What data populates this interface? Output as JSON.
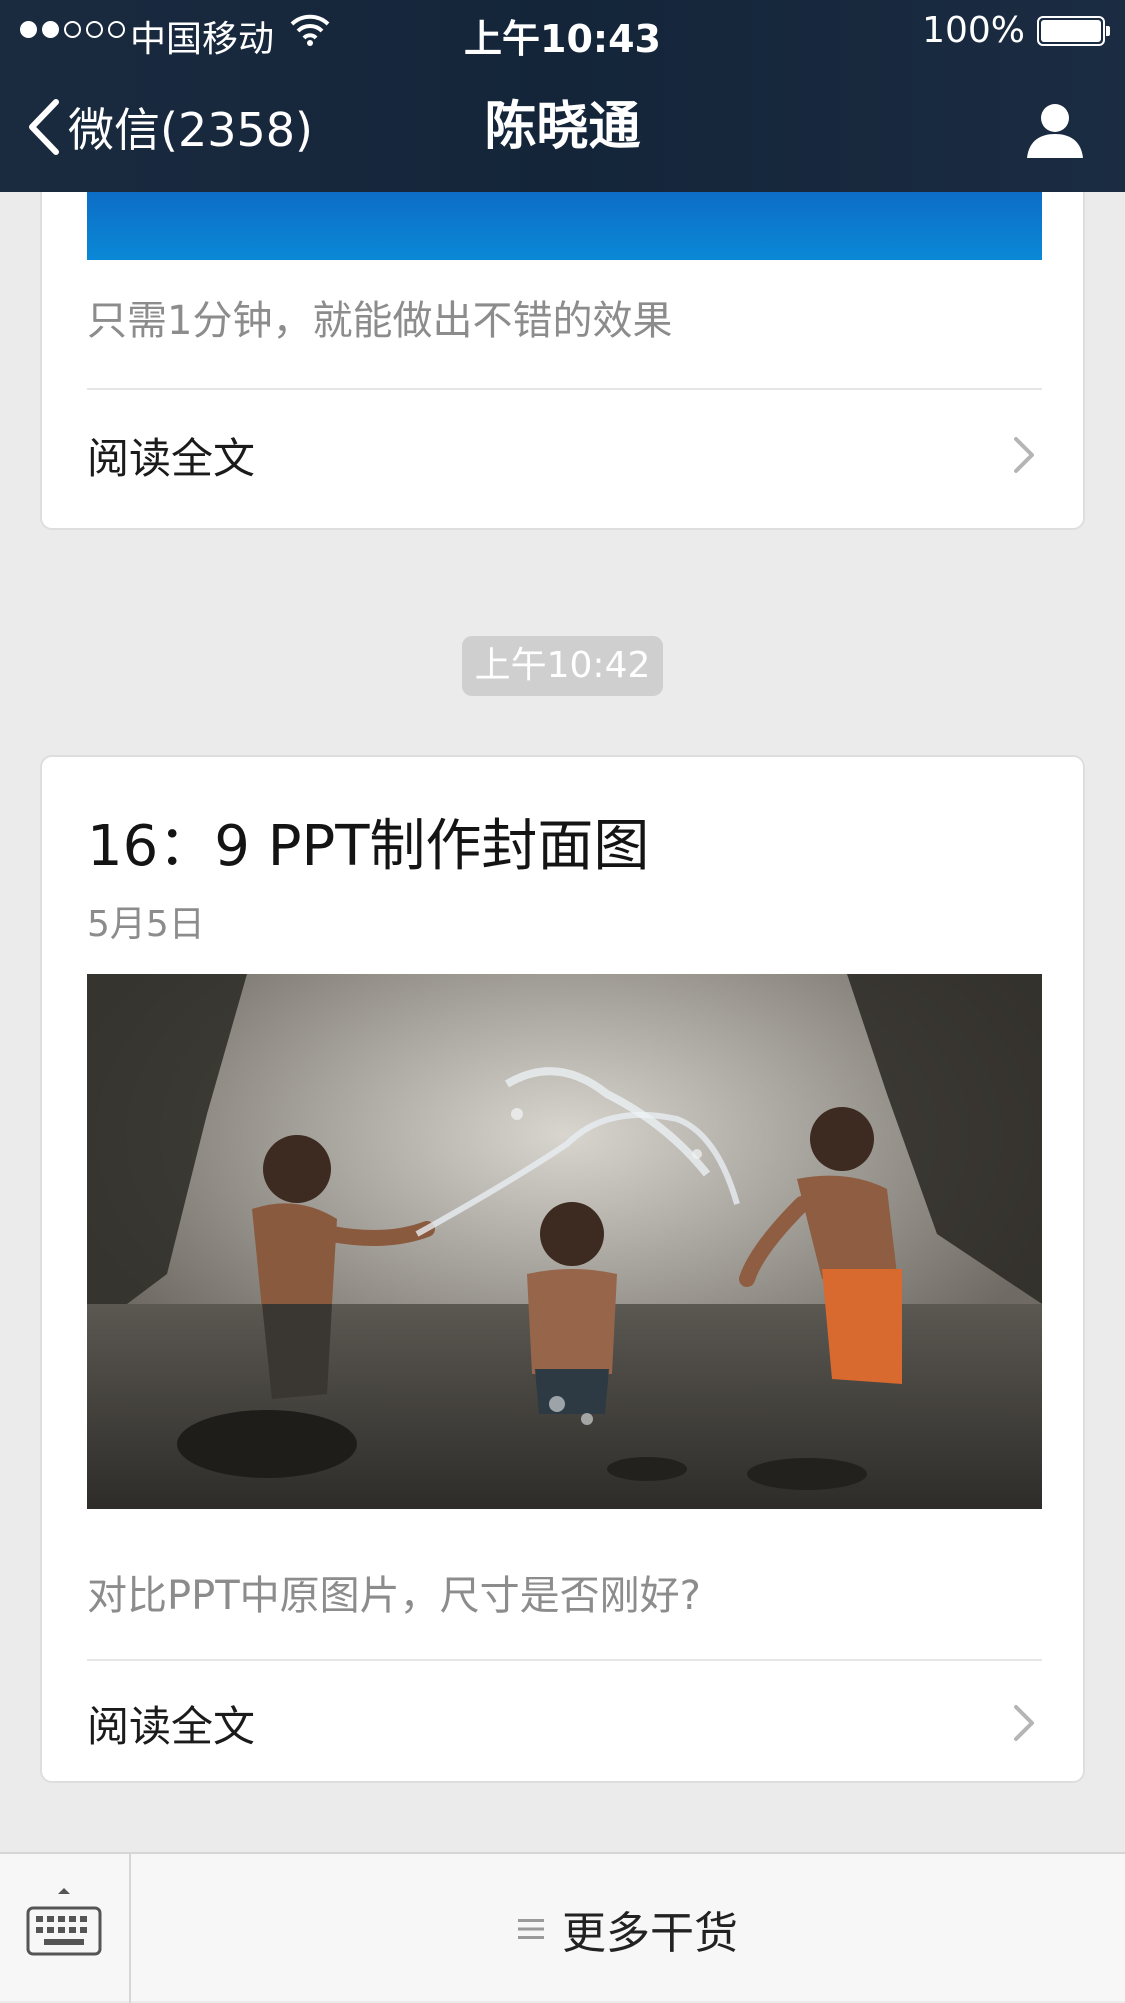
{
  "status_bar": {
    "carrier": "中国移动",
    "time": "上午10:43",
    "battery": "100%"
  },
  "nav": {
    "back_label": "微信(2358)",
    "title": "陈晓通"
  },
  "messages": [
    {
      "description": "只需1分钟，就能做出不错的效果",
      "read_more": "阅读全文"
    },
    {
      "title": "16：9 PPT制作封面图",
      "date": "5月5日",
      "description": "对比PPT中原图片，尺寸是否刚好?",
      "read_more": "阅读全文"
    }
  ],
  "timestamp": "上午10:42",
  "bottom_bar": {
    "menu_label": "更多干货"
  },
  "colors": {
    "nav_background": "#14253a",
    "page_background": "#ebebeb",
    "banner_blue": "#0a88d6"
  },
  "icons": {
    "back": "chevron-left-icon",
    "profile": "person-icon",
    "read_more": "chevron-right-icon",
    "keyboard": "keyboard-icon",
    "menu": "menu-lines-icon"
  }
}
